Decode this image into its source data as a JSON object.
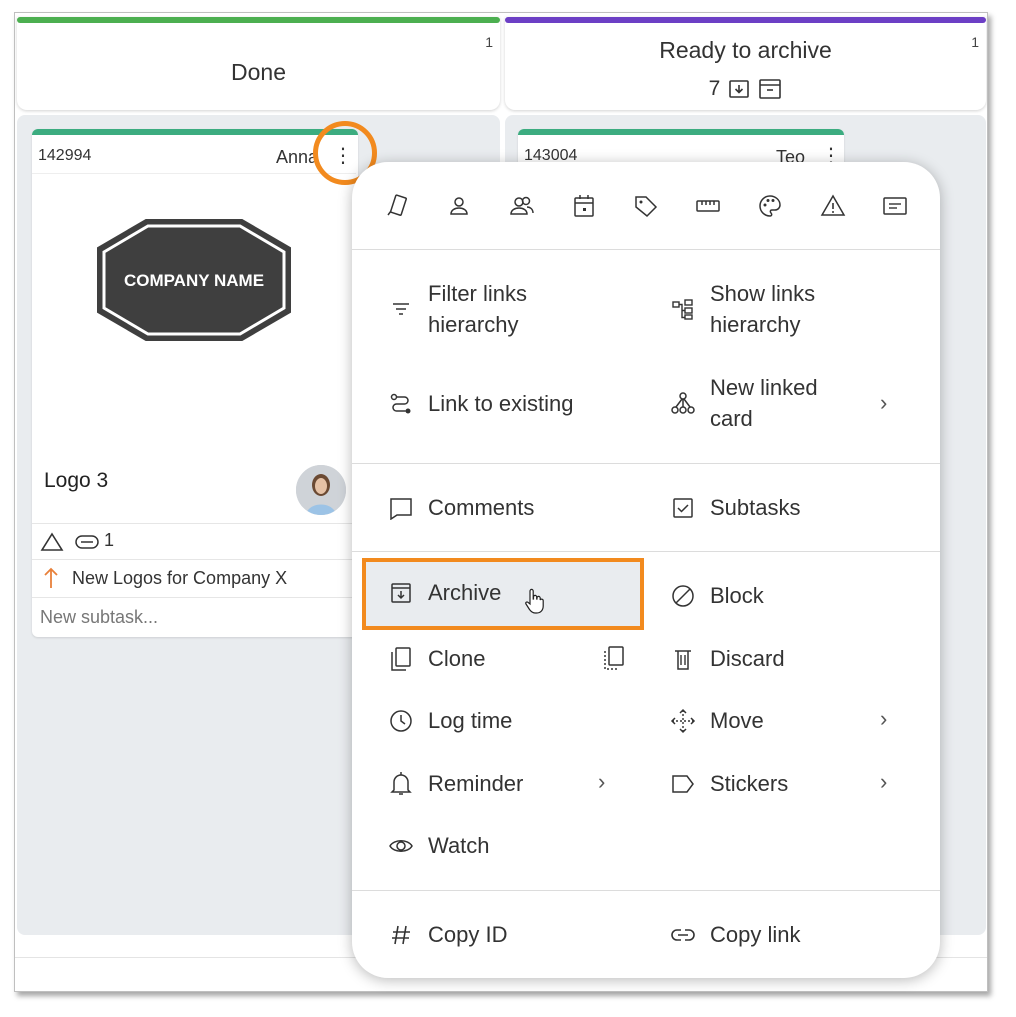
{
  "columns": [
    {
      "title": "Done",
      "count": "1",
      "accent": "#4caf50"
    },
    {
      "title": "Ready to archive",
      "count": "1",
      "subcount": "7",
      "accent": "#6c3fc5"
    }
  ],
  "cards": [
    {
      "id": "142994",
      "owner": "Anna",
      "title": "Logo 3",
      "logo_text": "COMPANY NAME",
      "attachments": "1",
      "parent_link": "New Logos for Company X",
      "subtask_placeholder": "New subtask..."
    },
    {
      "id": "143004",
      "owner": "Teo"
    }
  ],
  "menu": {
    "icon_toolbar": [
      "card-type-icon",
      "owner-icon",
      "members-icon",
      "calendar-icon",
      "tag-icon",
      "size-icon",
      "color-icon",
      "warning-icon",
      "description-icon"
    ],
    "links": {
      "filter_links": "Filter links hierarchy",
      "show_links": "Show links hierarchy",
      "link_existing": "Link to existing",
      "new_linked": "New linked card"
    },
    "comments": "Comments",
    "subtasks": "Subtasks",
    "archive": "Archive",
    "block": "Block",
    "clone": "Clone",
    "discard": "Discard",
    "log_time": "Log time",
    "move": "Move",
    "reminder": "Reminder",
    "stickers": "Stickers",
    "watch": "Watch",
    "copy_id": "Copy ID",
    "copy_link": "Copy link",
    "chevron": "›"
  },
  "colors": {
    "highlight": "#f28a1e",
    "card_accent": "#3cac80"
  }
}
